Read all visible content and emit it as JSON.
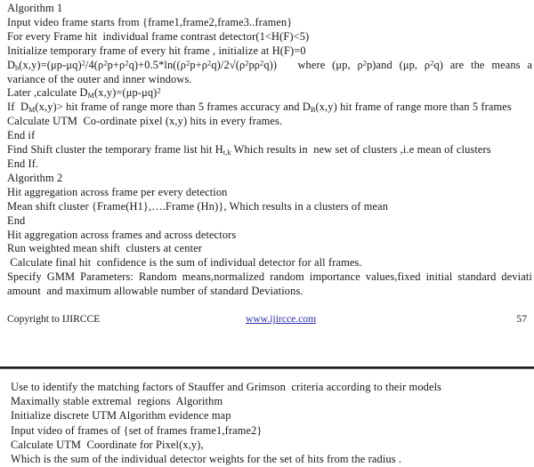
{
  "document": {
    "background_color": "#ffffff",
    "text_color": "#171717",
    "link_color": "#2a2ab0"
  },
  "algorithm_block": {
    "lines": [
      "Algorithm 1",
      "Input video frame starts from {frame1,frame2,frame3..framen}",
      "For every Frame hit  individual frame contrast detector(1<H(F)<5)",
      "Initialize temporary frame of every hit frame , initialize at H(F)=0",
      "Later ,calculate D",
      "Calculate UTM  Co-ordinate pixel (x,y) hits in every frames.",
      "End if",
      "End If.",
      "Algorithm 2",
      "Hit aggregation across frame per every detection",
      "Mean shift cluster {Frame(H1},….Frame (Hn)}, Which results in a clusters of mean",
      "End",
      "Hit aggregation across frames and across detectors",
      "Run weighted mean shift  clusters at center",
      " Calculate final hit  confidence is the sum of individual detector for all frames.",
      "amount  and maximum allowable number of standard Deviations."
    ],
    "formula_db": {
      "prefix": "D",
      "sub_b": "b",
      "body_1": "(x,y)=(μp-μq)",
      "sup_2a": "2",
      "body_2": "/4(ρ",
      "sup_2b": "2",
      "body_3": "p+ρ",
      "sup_2c": "2",
      "body_4": "q)+0.5*ln((ρ",
      "sup_2d": "2",
      "body_5": "p+ρ",
      "sup_2e": "2",
      "body_6": "q)/2√(ρ",
      "sup_2f": "2",
      "body_7": "pρ",
      "sup_2g": "2",
      "body_8": "q))",
      "tail_where": "where  (μp,  ρ",
      "sup_2h": "2",
      "tail_2": "p)and  (μp,  ρ",
      "sup_2i": "2",
      "tail_3": "q)  are  the  means  a"
    },
    "formula_db_wrap": "variance of the outer and inner windows.",
    "formula_dm": {
      "prefix_text": "Later ,calculate D",
      "sub_m": "M",
      "body": "(x,y)=(μp-μq)",
      "sup": "2"
    },
    "line_if_dm": {
      "part_1": "If  D",
      "sub_m": "M",
      "part_2": "(x,y)> hit frame of range more than 5 frames accuracy and D",
      "sub_b": "B",
      "part_3": "(x,y) hit frame of range more than 5 frames"
    },
    "line_find_shift": {
      "part_1": "Find Shift cluster the temporary frame list hit H",
      "sub_tk": "t,k",
      "part_2": " Which results in  new set of clusters ,i.e mean of clusters"
    },
    "line_gmm": "Specify GMM Parameters: Random means,normalized random importance values,fixed initial standard deviati"
  },
  "footer": {
    "copyright": "Copyright to IJIRCCE",
    "website": "www.ijircce.com",
    "page_number": "57"
  },
  "lower_block": {
    "lines": [
      "Use to identify the matching factors of Stauffer and Grimson  criteria according to their models",
      "Maximally stable extremal  regions  Algorithm",
      "Initialize discrete UTM Algorithm evidence map",
      "Input video of frames of {set of frames frame1,frame2}",
      "Calculate UTM  Coordinate for Pixel(x,y),",
      "Which is the sum of the individual detector weights for the set of hits from the radius ."
    ]
  }
}
